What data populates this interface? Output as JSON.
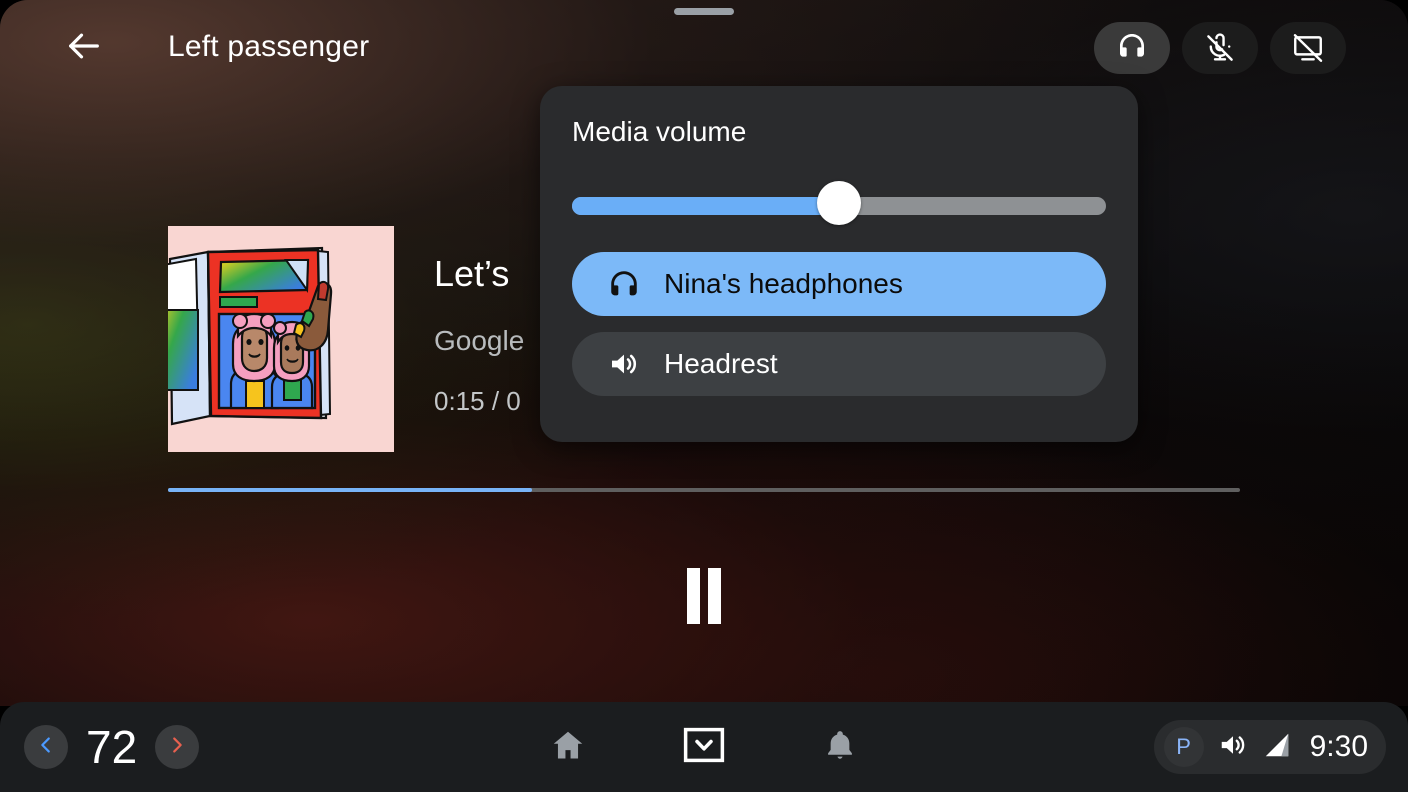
{
  "header": {
    "back_icon": "arrow-left-icon",
    "title": "Left passenger",
    "actions": [
      {
        "name": "headphones-toggle",
        "icon": "headphones-icon",
        "active": true
      },
      {
        "name": "mic-off-toggle",
        "icon": "mic-off-icon",
        "active": false
      },
      {
        "name": "screen-off-toggle",
        "icon": "screen-off-icon",
        "active": false
      }
    ]
  },
  "media": {
    "album_art_alt": "album-art-illustration",
    "title": "Let’s",
    "artist": "Google",
    "time": "0:15 / 0",
    "progress_percent": 34,
    "play_state_icon": "pause-icon"
  },
  "volume_popup": {
    "title": "Media volume",
    "slider": {
      "name": "media-volume-slider",
      "value_percent": 50,
      "fill_color": "#6aaef7",
      "track_color": "#8e9194",
      "thumb_color": "#ffffff"
    },
    "outputs": [
      {
        "name": "output-nina-headphones",
        "label": "Nina's headphones",
        "icon": "headphones-icon",
        "selected": true,
        "bg": "#7cb9f8"
      },
      {
        "name": "output-headrest",
        "label": "Headrest",
        "icon": "volume-up-icon",
        "selected": false,
        "bg": "#3d4043"
      }
    ]
  },
  "system_bar": {
    "temperature": {
      "decrease_icon": "chevron-left-icon",
      "decrease_color": "#4c9aff",
      "value": "72",
      "increase_icon": "chevron-right-icon",
      "increase_color": "#e8604f"
    },
    "nav": [
      {
        "name": "nav-home",
        "icon": "home-icon"
      },
      {
        "name": "nav-app-drawer",
        "icon": "chevron-down-boxed-icon"
      },
      {
        "name": "nav-notifications",
        "icon": "bell-icon"
      }
    ],
    "status": {
      "gear_label": "P",
      "gear_color": "#8ab4f8",
      "volume_icon": "volume-up-icon",
      "signal_icon": "signal-bars-icon",
      "clock": "9:30"
    }
  },
  "colors": {
    "accent_blue": "#7cb9f8",
    "panel_bg": "#2a2b2d",
    "sysbar_bg": "#1b1d1f"
  }
}
